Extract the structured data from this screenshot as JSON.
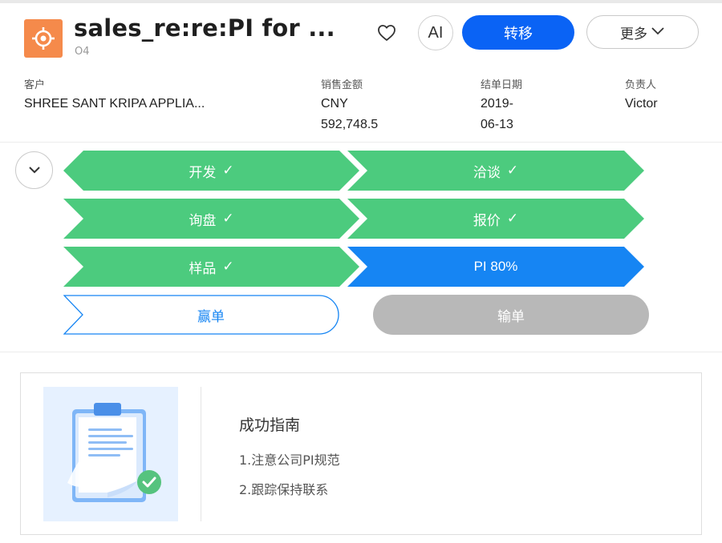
{
  "header": {
    "title": "sales_re:re:PI for ...",
    "subtitle": "O4",
    "ai_label": "AI",
    "primary_action": "转移",
    "more_action": "更多"
  },
  "fields": [
    {
      "label": "客户",
      "value": "SHREE SANT KRIPA APPLIA..."
    },
    {
      "label": "销售金额",
      "value_line1": "CNY",
      "value_line2": "592,748.5"
    },
    {
      "label": "结单日期",
      "value_line1": "2019-",
      "value_line2": "06-13"
    },
    {
      "label": "负责人",
      "value": "Victor"
    }
  ],
  "stages": [
    {
      "label": "开发",
      "check": "✓",
      "status": "done"
    },
    {
      "label": "洽谈",
      "check": "✓",
      "status": "done"
    },
    {
      "label": "询盘",
      "check": "✓",
      "status": "done"
    },
    {
      "label": "报价",
      "check": "✓",
      "status": "done"
    },
    {
      "label": "样品",
      "check": "✓",
      "status": "done"
    },
    {
      "label": "PI 80%",
      "status": "active"
    }
  ],
  "outcomes": {
    "win": "赢单",
    "lose": "输单"
  },
  "guide": {
    "title": "成功指南",
    "items": [
      "1.注意公司PI规范",
      "2.跟踪保持联系"
    ]
  },
  "colors": {
    "primary": "#0a63f5",
    "stage_done": "#4ccb7e",
    "stage_active": "#1685f3",
    "lose": "#b8b8b8",
    "app_icon": "#f58a4b"
  },
  "icons": {
    "app": "target-icon",
    "favorite": "heart-icon",
    "more": "chevron-down-icon",
    "collapse": "chevron-down-icon",
    "guide": "clipboard-check-icon"
  }
}
